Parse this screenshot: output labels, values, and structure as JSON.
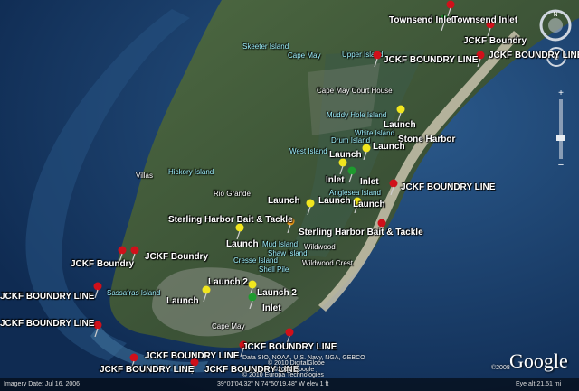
{
  "map": {
    "labels": {
      "townsend_inlet_a": "Townsend Inlet",
      "townsend_inlet_b": "Townsend Inlet",
      "jckf_boundry_ne": "JCKF Boundry",
      "jckf_line_ne1": "JCKF BOUNDRY LINE",
      "jckf_line_ne2": "JCKF BOUNDRY LINE",
      "launch_1": "Launch",
      "stone_harbor": "Stone Harbor",
      "launch_2": "Launch",
      "launch_3": "Launch",
      "inlet_1": "Inlet",
      "inlet_2": "Inlet",
      "jckf_line_east": "JCKF BOUNDRY LINE",
      "launch_4": "Launch",
      "launch_5": "Launch",
      "launch_6": "Launch",
      "sterling_1": "Sterling Harbor Bait & Tackle",
      "sterling_2": "Sterling Harbor Bait & Tackle",
      "launch_7": "Launch",
      "jckf_boundry_w1": "JCKF Boundry",
      "jckf_boundry_w2": "JCKF Boundry",
      "jckf_line_w1": "JCKF BOUNDRY LINE",
      "launch_8": "Launch",
      "launch_9": "Launch 2",
      "launch_10": "Launch 2",
      "inlet_3": "Inlet",
      "jckf_line_w2": "JCKF BOUNDRY LINE",
      "jckf_line_s1": "JCKF BOUNDRY LINE",
      "jckf_line_s2": "JCKF BOUNDRY LINE",
      "jckf_line_s3": "JCKF BOUNDRY LINE",
      "jckf_line_s4": "JCKF BOUNDRY LINE"
    },
    "places": {
      "skeeter_island": "Skeeter Island",
      "cape_may_n": "Cape May",
      "upper_island": "Upper Island",
      "cape_may_court_house": "Cape May Court House",
      "muddy_hole_island": "Muddy Hole Island",
      "white_island": "White Island",
      "drum_island": "Drum Island",
      "west_island": "West Island",
      "hickory_island": "Hickory Island",
      "villas": "Villas",
      "rio_grande": "Rio Grande",
      "anglesea_island": "Anglesea Island",
      "wildwood": "Wildwood",
      "mud_island": "Mud Island",
      "shaw_island": "Shaw Island",
      "cresse_island": "Cresse Island",
      "wildwood_crest": "Wildwood Crest",
      "shell_pile": "Shell Pile",
      "sassafras_island": "Sassafras Island",
      "cape_may_s": "Cape May"
    },
    "status": {
      "imagery_date": "Imagery Date: Jul 16, 2006",
      "coords": "39°01'04.32\" N    74°50'19.48\" W   elev    1 ft",
      "eye_alt": "Eye alt  21.51 mi"
    },
    "copyright": {
      "line1": "Data SIO, NOAA, U.S. Navy, NGA, GEBCO",
      "line2": "© 2010 Europa Technologies",
      "line3": "© 2010 DigitalGlobe",
      "line4": "©2010 Google",
      "brand_year": "©2008"
    },
    "brand": "Google",
    "colors": {
      "ocean": "#1b3f6e",
      "land": "#3f5a3a",
      "pin_red": "#d0101a",
      "pin_yellow": "#f1e61f",
      "pin_green": "#1e9b2e",
      "pin_orange": "#f09b1a"
    },
    "icons": [
      "compass-icon",
      "zoom-in-icon",
      "zoom-out-icon",
      "look-control-icon"
    ]
  }
}
